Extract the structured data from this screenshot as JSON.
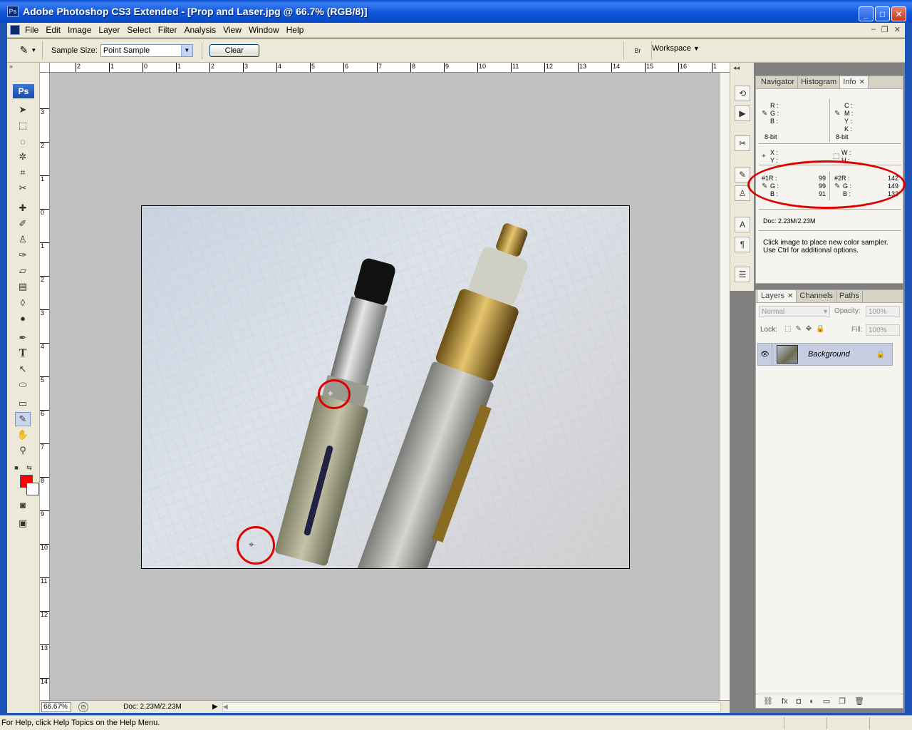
{
  "window": {
    "title": "Adobe Photoshop CS3 Extended - [Prop and Laser.jpg @ 66.7% (RGB/8)]",
    "app_icon": "Ps",
    "buttons": [
      "_",
      "□",
      "✕"
    ]
  },
  "menubar": {
    "items": [
      "File",
      "Edit",
      "Image",
      "Layer",
      "Select",
      "Filter",
      "Analysis",
      "View",
      "Window",
      "Help"
    ]
  },
  "options": {
    "sample_size_label": "Sample Size:",
    "sample_size_value": "Point Sample",
    "clear_label": "Clear",
    "workspace_label": "Workspace"
  },
  "toolbox": {
    "logo": "Ps",
    "foreground_color": "#ff0000",
    "background_color": "#ffffff"
  },
  "rulers": {
    "top": [
      "2",
      "1",
      "0",
      "1",
      "2",
      "3",
      "4",
      "5",
      "6",
      "7",
      "8",
      "9",
      "10",
      "11",
      "12",
      "13",
      "14",
      "15",
      "16",
      "1"
    ],
    "left": [
      "3",
      "2",
      "1",
      "0",
      "1",
      "2",
      "3",
      "4",
      "5",
      "6",
      "7",
      "8",
      "9",
      "10",
      "11",
      "12",
      "13",
      "14"
    ]
  },
  "document_status": {
    "zoom": "66.67%",
    "doc_size": "Doc: 2.23M/2.23M"
  },
  "info_panel": {
    "tabs": [
      "Navigator",
      "Histogram",
      "Info"
    ],
    "active_tab": "Info",
    "rgb": {
      "r": "R :",
      "g": "G :",
      "b": "B :",
      "bit": "8-bit"
    },
    "cmyk": {
      "c": "C :",
      "m": "M :",
      "y": "Y :",
      "k": "K :",
      "bit": "8-bit"
    },
    "xy": {
      "x": "X :",
      "y": "Y :"
    },
    "wh": {
      "w": "W :",
      "h": "H :"
    },
    "sampler1": {
      "label_r": "#1R :",
      "label_g": "G :",
      "label_b": "B :",
      "r": "99",
      "g": "99",
      "b": "91"
    },
    "sampler2": {
      "label_r": "#2R :",
      "label_g": "G :",
      "label_b": "B :",
      "r": "142",
      "g": "149",
      "b": "133"
    },
    "doc": "Doc: 2.23M/2.23M",
    "hint_line1": "Click image to place new color sampler.",
    "hint_line2": "Use Ctrl for additional options."
  },
  "layers_panel": {
    "tabs": [
      "Layers",
      "Channels",
      "Paths"
    ],
    "blend_mode": "Normal",
    "opacity_label": "Opacity:",
    "opacity": "100%",
    "lock_label": "Lock:",
    "fill_label": "Fill:",
    "fill": "100%",
    "layers": [
      {
        "name": "Background"
      }
    ]
  },
  "statusbar": {
    "text": "For Help, click Help Topics on the Help Menu."
  },
  "annotation_color": "#e00000"
}
